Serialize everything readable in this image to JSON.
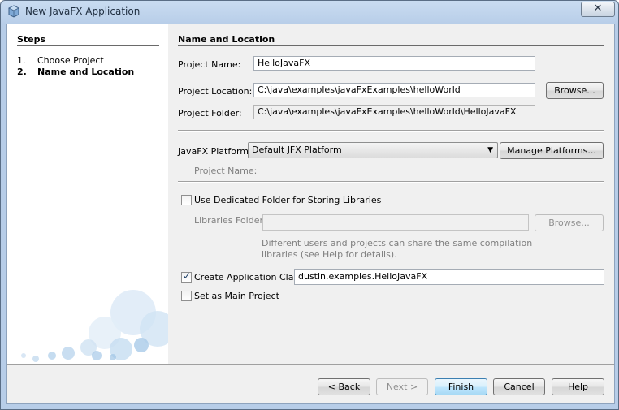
{
  "window": {
    "title": "New JavaFX Application"
  },
  "steps": {
    "title": "Steps",
    "items": [
      {
        "num": "1.",
        "label": "Choose Project"
      },
      {
        "num": "2.",
        "label": "Name and Location"
      }
    ]
  },
  "main": {
    "title": "Name and Location",
    "project_name_label": "Project Name:",
    "project_name_value": "HelloJavaFX",
    "project_location_label": "Project Location:",
    "project_location_value": "C:\\java\\examples\\javaFxExamples\\helloWorld",
    "browse_label": "Browse...",
    "project_folder_label": "Project Folder:",
    "project_folder_value": "C:\\java\\examples\\javaFxExamples\\helloWorld\\HelloJavaFX",
    "platform_label": "JavaFX Platform:",
    "platform_value": "Default JFX Platform",
    "manage_platforms_label": "Manage Platforms...",
    "platform_project_name_label": "Project Name:",
    "dedicated_folder_label": "Use Dedicated Folder for Storing Libraries",
    "dedicated_folder_checked": false,
    "libraries_folder_label": "Libraries Folder:",
    "libraries_folder_value": "",
    "libraries_browse_label": "Browse...",
    "help_text_line1": "Different users and projects can share the same compilation",
    "help_text_line2": "libraries (see Help for details).",
    "create_app_class_label": "Create Application Class",
    "create_app_class_checked": true,
    "app_class_value": "dustin.examples.HelloJavaFX",
    "set_main_label": "Set as Main Project",
    "set_main_checked": false
  },
  "buttons": {
    "back": "< Back",
    "next": "Next >",
    "finish": "Finish",
    "cancel": "Cancel",
    "help": "Help"
  },
  "colors": {
    "accent": "#3c7fb1",
    "titlebar": "#b7cde8",
    "client_bg": "#f0f0f0"
  }
}
